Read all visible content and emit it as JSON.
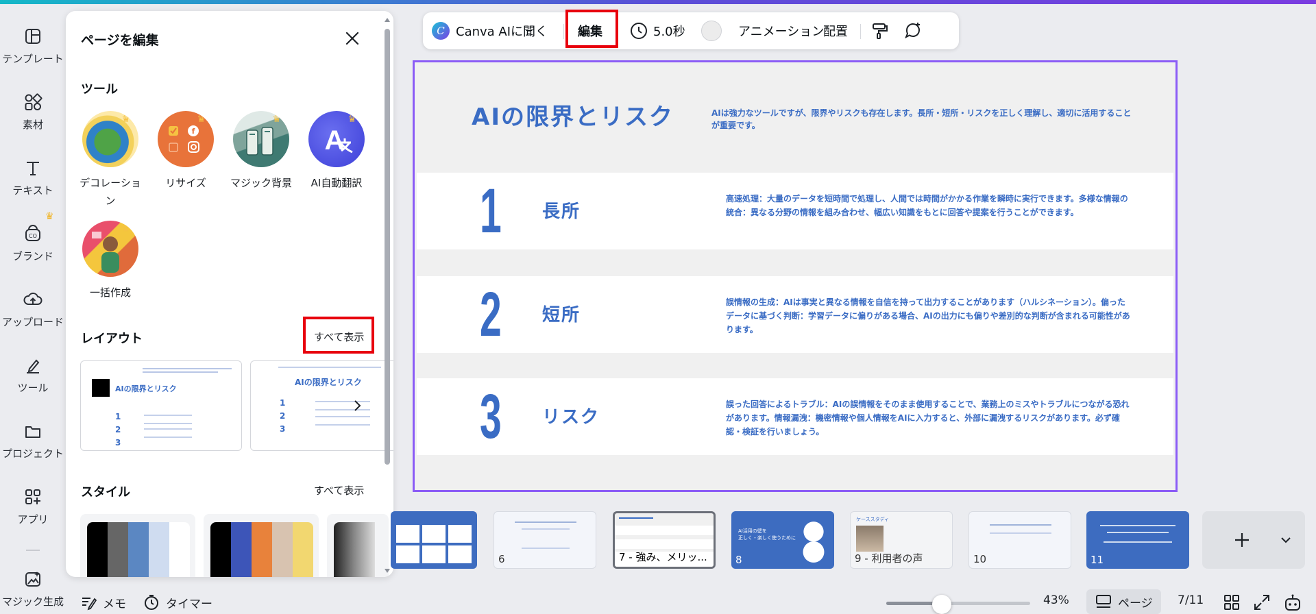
{
  "rail": {
    "items": [
      {
        "label": "テンプレート"
      },
      {
        "label": "素材"
      },
      {
        "label": "テキスト"
      },
      {
        "label": "ブランド"
      },
      {
        "label": "アップロード"
      },
      {
        "label": "ツール"
      },
      {
        "label": "プロジェクト"
      },
      {
        "label": "アプリ"
      },
      {
        "label": "マジック生成"
      }
    ]
  },
  "panel": {
    "title": "ページを編集",
    "tools_title": "ツール",
    "tools": [
      {
        "label": "デコレーション"
      },
      {
        "label": "リサイズ"
      },
      {
        "label": "マジック背景"
      },
      {
        "label": "AI自動翻訳"
      },
      {
        "label": "一括作成"
      }
    ],
    "layout_title": "レイアウト",
    "layout_see_all": "すべて表示",
    "layout_preview_title": "AIの限界とリスク",
    "style_title": "スタイル",
    "style_see_all": "すべて表示",
    "palettes": [
      [
        "#000000",
        "#666666",
        "#5b87c2",
        "#cfdcf0",
        "#ffffff"
      ],
      [
        "#000000",
        "#3d55b8",
        "#e8823b",
        "#d8c3b0",
        "#f2d770"
      ]
    ]
  },
  "toolbar": {
    "ask_ai": "Canva AIに聞く",
    "edit": "編集",
    "duration": "5.0秒",
    "animation": "アニメーション",
    "position": "配置"
  },
  "slide": {
    "title": "AIの限界とリスク",
    "intro": "AIは強力なツールですが、限界やリスクも存在します。長所・短所・リスクを正しく理解し、適切に活用することが重要です。",
    "sections": [
      {
        "num": "1",
        "heading": "長所",
        "body": "高速処理：大量のデータを短時間で処理し、人間では時間がかかる作業を瞬時に実行できます。多様な情報の統合：異なる分野の情報を組み合わせ、幅広い知識をもとに回答や提案を行うことができます。"
      },
      {
        "num": "2",
        "heading": "短所",
        "body": "誤情報の生成：AIは事実と異なる情報を自信を持って出力することがあります（ハルシネーション）。偏ったデータに基づく判断：学習データに偏りがある場合、AIの出力にも偏りや差別的な判断が含まれる可能性があります。"
      },
      {
        "num": "3",
        "heading": "リスク",
        "body": "誤った回答によるトラブル：AIの誤情報をそのまま使用することで、業務上のミスやトラブルにつながる恐れがあります。情報漏洩：機密情報や個人情報をAIに入力すると、外部に漏洩するリスクがあります。必ず確認・検証を行いましょう。"
      }
    ]
  },
  "filmstrip": {
    "thumbs": [
      {
        "label": ""
      },
      {
        "label": "6"
      },
      {
        "label": "7 - 強み、メリッ..."
      },
      {
        "label": "8"
      },
      {
        "label": "9 - 利用者の声"
      },
      {
        "label": "10"
      },
      {
        "label": "11"
      }
    ],
    "thumb8_title": "AI活用の壁を\n正しく・楽しく使うために",
    "thumb9_title": "ケーススタディ"
  },
  "bottombar": {
    "notes": "メモ",
    "timer": "タイマー",
    "zoom": "43%",
    "zoom_level": 0.43,
    "pages": "ページ",
    "page_count": "7/11"
  },
  "colors": {
    "accent": "#3a6cc4",
    "highlight": "#e8000d",
    "selection": "#8b5cf6"
  }
}
